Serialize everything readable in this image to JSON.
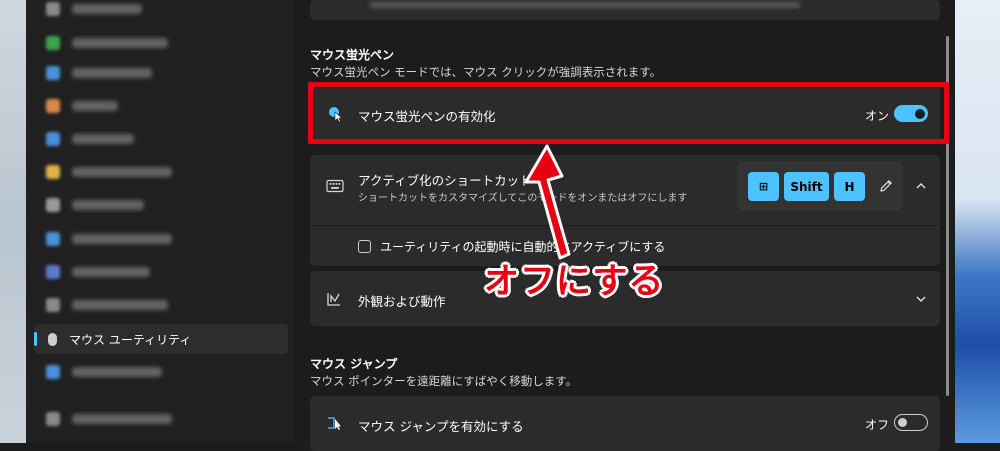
{
  "sidebar": {
    "items": [
      {
        "icon_color": "#8a8a8a"
      },
      {
        "icon_color": "#3fa34d"
      },
      {
        "icon_color": "#4a90d9"
      },
      {
        "icon_color": "#d98a4a"
      },
      {
        "icon_color": "#4a90d9"
      },
      {
        "icon_color": "#e0b24a"
      },
      {
        "icon_color": "#9a9a9a"
      },
      {
        "icon_color": "#4a90d9"
      },
      {
        "icon_color": "#5a7ac8"
      },
      {
        "icon_color": "#8a8a8a"
      },
      {
        "icon_color": "#9a9a9a"
      },
      {
        "icon_color": "#4a90d9"
      },
      {
        "icon_color": "#8a8a8a"
      }
    ],
    "active_label": "マウス ユーティリティ"
  },
  "highlighter": {
    "title": "マウス蛍光ペン",
    "description": "マウス蛍光ペン モードでは、マウス クリックが強調表示されます。",
    "enable_label": "マウス蛍光ペンの有効化",
    "enable_state": "オン",
    "shortcut_label": "アクティブ化のショートカット",
    "shortcut_sub": "ショートカットをカスタマイズしてこのモードをオンまたはオフにします",
    "keys": [
      "⊞",
      "Shift",
      "H"
    ],
    "auto_activate_label": "ユーティリティの起動時に自動的にアクティブにする",
    "appearance_label": "外観および動作"
  },
  "mouse_jump": {
    "title": "マウス ジャンプ",
    "description": "マウス ポインターを遠距離にすばやく移動します。",
    "enable_label": "マウス ジャンプを有効にする",
    "enable_state": "オフ"
  },
  "annotation": {
    "callout": "オフにする",
    "color": "#e60012"
  },
  "colors": {
    "accent": "#4cc2ff"
  }
}
